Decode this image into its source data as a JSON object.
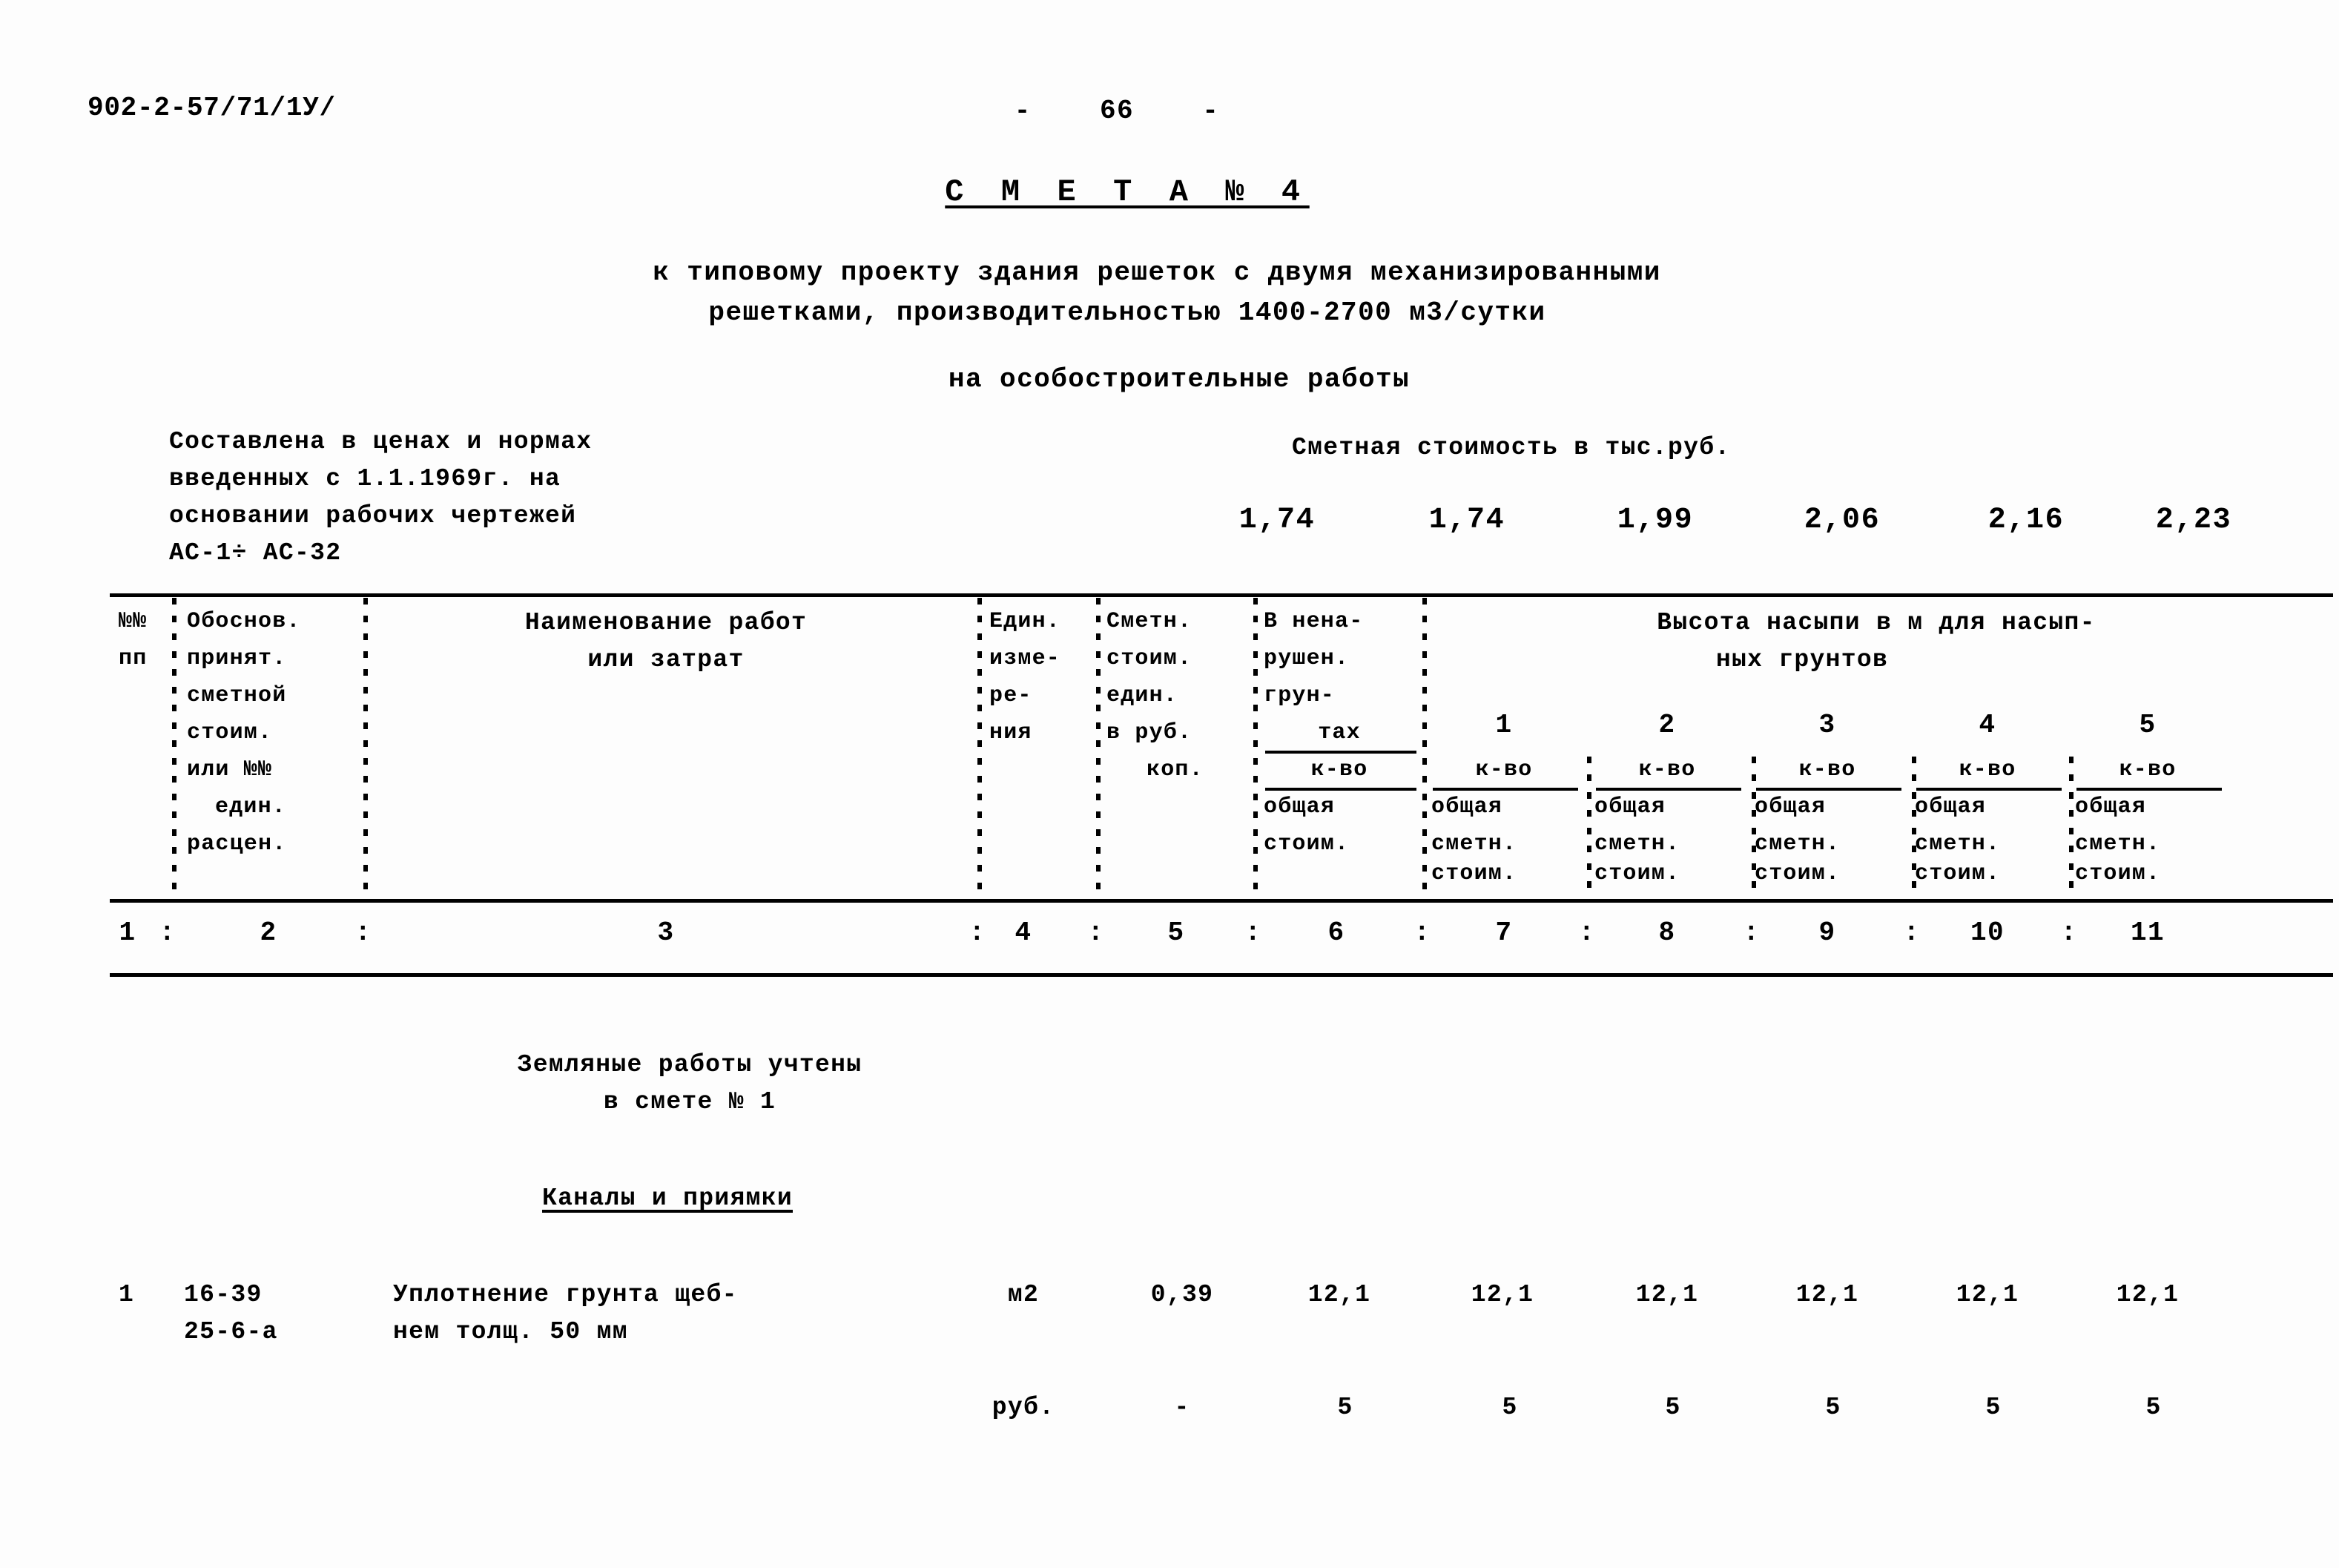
{
  "document": {
    "code": "902-2-57/71/1У/",
    "page_marker": "-    66    -",
    "title": "С М Е Т А № 4",
    "subtitle_line1": "к типовому проекту здания решеток с двумя механизированными",
    "subtitle_line2": "решетками, производительностью 1400-2700 м3/сутки",
    "subtitle_line3": "на особостроительные работы"
  },
  "basis": {
    "line1": "Составлена в ценах и нормах",
    "line2": "введенных с 1.1.1969г. на",
    "line3": "основании рабочих чертежей",
    "line4": "АС-1÷ АС-32"
  },
  "cost_summary": {
    "label": "Сметная стоимость в тыс.руб.",
    "values": [
      "1,74",
      "1,74",
      "1,99",
      "2,06",
      "2,16",
      "2,23"
    ]
  },
  "table": {
    "header": {
      "col1": [
        "№№",
        "пп"
      ],
      "col2": [
        "Обоснов.",
        "принят.",
        "сметной",
        "стоим.",
        "или №№",
        "един.",
        "расцен."
      ],
      "col3": [
        "Наименование работ",
        "или затрат"
      ],
      "col4": [
        "Един.",
        "изме-",
        "ре-",
        "ния"
      ],
      "col5": [
        "Сметн.",
        "стоим.",
        "един.",
        "в руб.",
        "коп."
      ],
      "col6": {
        "title": [
          "В нена-",
          "рушен.",
          "грун-",
          "тах"
        ],
        "numerator": "к-во",
        "denominator": [
          "общая",
          "стоим."
        ]
      },
      "group": {
        "line1": "Высота насыпи в м для насып-",
        "line2": "ных грунтов",
        "subcolumns": [
          "1",
          "2",
          "3",
          "4",
          "5"
        ],
        "numerator": "к-во",
        "denominator": [
          "общая",
          "сметн.",
          "стоим."
        ]
      }
    },
    "column_numbers": [
      "1",
      "2",
      "3",
      "4",
      "5",
      "6",
      "7",
      "8",
      "9",
      "10",
      "11"
    ],
    "notes": {
      "note_line1": "Земляные работы учтены",
      "note_line2": "в смете № 1",
      "section_heading": "Каналы и приямки"
    },
    "rows": [
      {
        "num": "1",
        "basis": [
          "16-39",
          "25-6-а"
        ],
        "name": [
          "Уплотнение грунта щеб-",
          "нем толщ. 50 мм"
        ],
        "unit": "м2",
        "unit_cost": "0,39",
        "undisturbed": "12,1",
        "heights": [
          "12,1",
          "12,1",
          "12,1",
          "12,1",
          "12,1"
        ],
        "currency_label": "руб.",
        "currency_unit_cost": "-",
        "currency_undisturbed": "5",
        "currency_heights": [
          "5",
          "5",
          "5",
          "5",
          "5"
        ]
      }
    ]
  }
}
